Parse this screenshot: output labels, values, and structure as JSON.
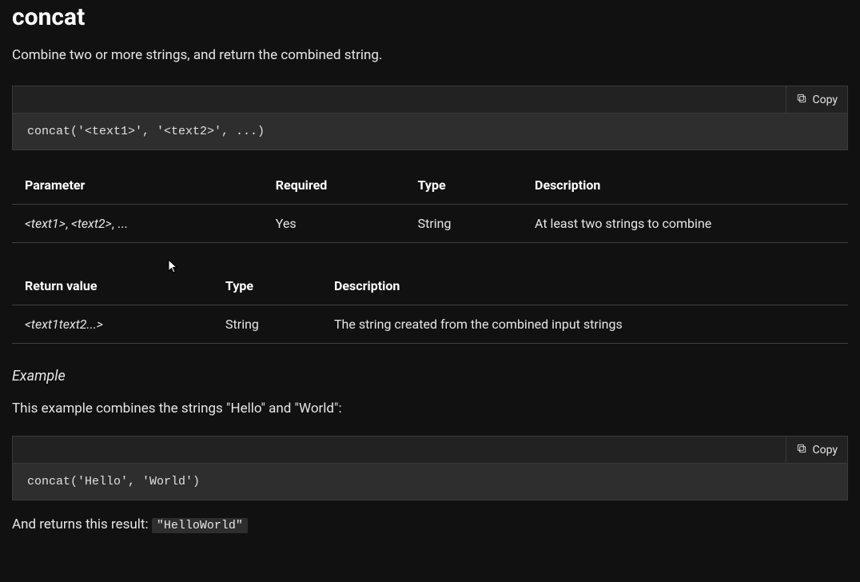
{
  "title": "concat",
  "intro": "Combine two or more strings, and return the combined string.",
  "copyLabel": "Copy",
  "code1": "concat('<text1>', '<text2>', ...)",
  "paramsTable": {
    "headers": [
      "Parameter",
      "Required",
      "Type",
      "Description"
    ],
    "row": {
      "param_prefix": "<text1>",
      "param_sep1": ", ",
      "param_mid": "<text2>",
      "param_sep2": ", ",
      "param_rest": "...",
      "required": "Yes",
      "type": "String",
      "description": "At least two strings to combine"
    }
  },
  "returnTable": {
    "headers": [
      "Return value",
      "Type",
      "Description"
    ],
    "row": {
      "value": "<text1text2...>",
      "type": "String",
      "description": "The string created from the combined input strings"
    }
  },
  "exampleHeading": "Example",
  "exampleIntro": "This example combines the strings \"Hello\" and \"World\":",
  "code2": "concat('Hello', 'World')",
  "resultPrefix": "And returns this result: ",
  "resultValue": "\"HelloWorld\""
}
